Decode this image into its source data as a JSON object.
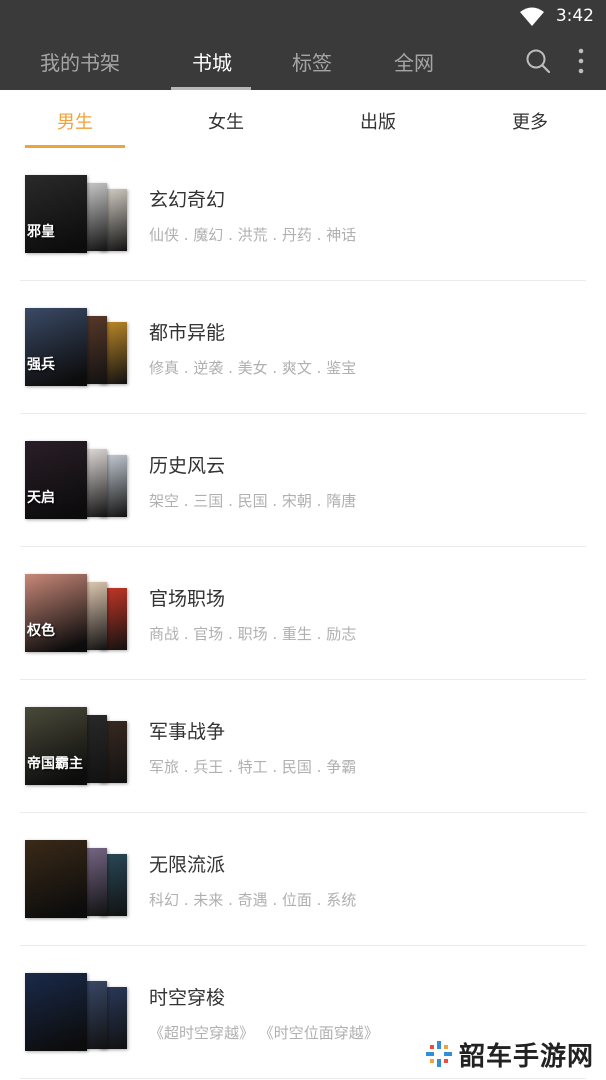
{
  "status": {
    "time": "3:42"
  },
  "nav": {
    "tabs": [
      {
        "label": "我的书架"
      },
      {
        "label": "书城"
      },
      {
        "label": "标签"
      },
      {
        "label": "全网"
      }
    ],
    "active_index": 1
  },
  "categories": {
    "tabs": [
      {
        "label": "男生"
      },
      {
        "label": "女生"
      },
      {
        "label": "出版"
      },
      {
        "label": "更多"
      }
    ],
    "active_index": 0
  },
  "genres": [
    {
      "title": "玄幻奇幻",
      "tags": "仙侠 . 魔幻 . 洪荒 . 丹药 . 神话",
      "cover_text": "邪皇",
      "colors": [
        "#2a2a2a",
        "#cfcfcf",
        "#d8d2c8"
      ]
    },
    {
      "title": "都市异能",
      "tags": "修真 . 逆袭 . 美女 . 爽文 . 鉴宝",
      "cover_text": "强兵",
      "colors": [
        "#3a4a66",
        "#5a3a2a",
        "#c08a2a"
      ]
    },
    {
      "title": "历史风云",
      "tags": "架空 . 三国 . 民国 . 宋朝 . 隋唐",
      "cover_text": "天启",
      "colors": [
        "#2a1e28",
        "#e8e2e0",
        "#c8d0d8"
      ]
    },
    {
      "title": "官场职场",
      "tags": "商战 . 官场 . 职场 . 重生 . 励志",
      "cover_text": "权色",
      "colors": [
        "#c88878",
        "#e8d0b8",
        "#c83828"
      ]
    },
    {
      "title": "军事战争",
      "tags": "军旅 . 兵王 . 特工 . 民国 . 争霸",
      "cover_text": "帝国霸主",
      "colors": [
        "#4a4a3a",
        "#2a2a2a",
        "#3a2a22"
      ]
    },
    {
      "title": "无限流派",
      "tags": "科幻 . 未来 . 奇遇 . 位面 . 系统",
      "cover_text": "",
      "colors": [
        "#3a2a18",
        "#7a6a8a",
        "#2a4a5a"
      ]
    },
    {
      "title": "时空穿梭",
      "tags": "《超时空穿越》 《时空位面穿越》",
      "cover_text": "",
      "colors": [
        "#1a2a4a",
        "#3a4a6a",
        "#2a3a5a"
      ]
    }
  ],
  "watermark": {
    "text": "韶车手游网",
    "accent": "#2f8fd8"
  },
  "theme": {
    "accent": "#f0a23c",
    "toolbar": "#3a3a3a"
  }
}
